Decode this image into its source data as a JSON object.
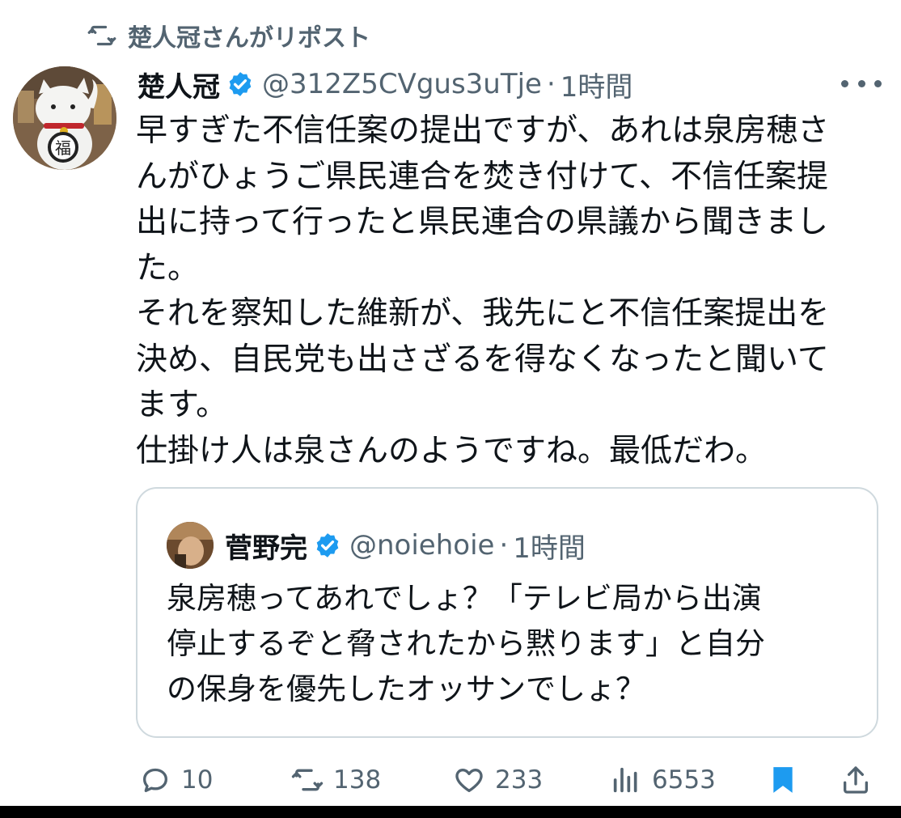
{
  "repost": {
    "label": "楚人冠さんがリポスト",
    "icon": "repost-icon"
  },
  "tweet": {
    "display_name": "楚人冠",
    "handle": "@312Z5CVgus3uTje",
    "separator": "·",
    "time": "1時間",
    "verified": true,
    "body_lines": [
      "早すぎた不信任案の提出ですが、あれは泉房穂さ",
      "んがひょうご県民連合を焚き付けて、不信任案提",
      "出に持って行ったと県民連合の県議から聞きまし",
      "た。",
      "それを察知した維新が、我先にと不信任案提出を",
      "決め、自民党も出さざるを得なくなったと聞いて",
      "ます。",
      "仕掛け人は泉さんのようですね。最低だわ。"
    ]
  },
  "quote": {
    "display_name": "菅野完",
    "handle": "@noiehoie",
    "separator": "·",
    "time": "1時間",
    "verified": true,
    "body_lines": [
      "泉房穂ってあれでしょ？「テレビ局から出演",
      "停止するぞと脅されたから黙ります」と自分",
      "の保身を優先したオッサンでしょ？"
    ]
  },
  "actions": {
    "replies": "10",
    "reposts": "138",
    "likes": "233",
    "views": "6553"
  },
  "colors": {
    "text": "#0f1419",
    "secondary": "#536471",
    "verified": "#1d9bf0",
    "bookmark": "#1d9bf0",
    "border": "#cfd9de"
  }
}
